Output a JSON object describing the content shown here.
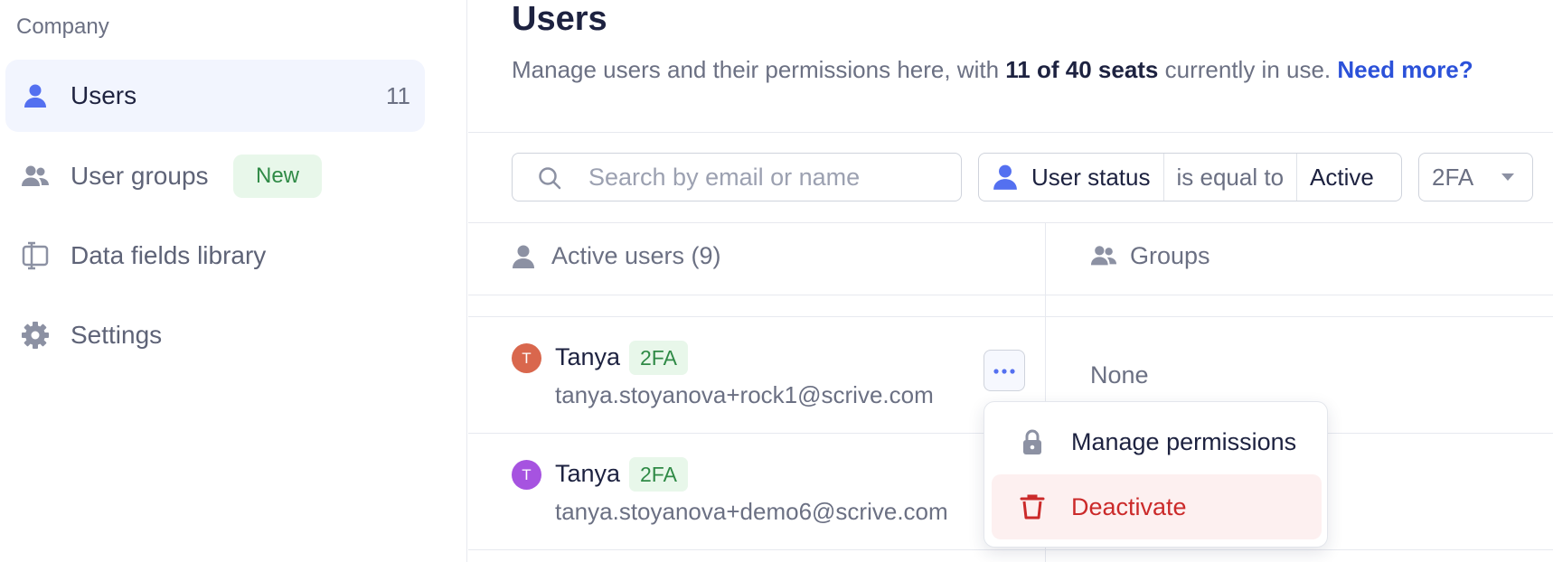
{
  "sidebar": {
    "section_title": "Company",
    "items": [
      {
        "label": "Users",
        "icon": "user-icon",
        "count": "11",
        "active": true
      },
      {
        "label": "User groups",
        "icon": "user-group-icon",
        "badge": "New"
      },
      {
        "label": "Data fields library",
        "icon": "data-fields-icon"
      },
      {
        "label": "Settings",
        "icon": "gear-icon"
      }
    ]
  },
  "header": {
    "title": "Users",
    "subtitle_prefix": "Manage users and their permissions here, with ",
    "subtitle_seats": "11 of 40 seats",
    "subtitle_suffix": " currently in use.",
    "need_more_link": "Need more?"
  },
  "toolbar": {
    "search_placeholder": "Search by email or name",
    "filter": {
      "field": "User status",
      "operator": "is equal to",
      "value": "Active"
    },
    "twofa_select": "2FA"
  },
  "table": {
    "columns": [
      {
        "label": "Active users (9)",
        "icon": "user-icon"
      },
      {
        "label": "Groups",
        "icon": "user-group-icon"
      }
    ],
    "rows": [
      {
        "avatar": "T",
        "avatar_color": "#d9674d",
        "name": "Tanya",
        "badge": "2FA",
        "email": "tanya.stoyanova+rock1@scrive.com",
        "groups": "None"
      },
      {
        "avatar": "T",
        "avatar_color": "#a653e0",
        "name": "Tanya",
        "badge": "2FA",
        "email": "tanya.stoyanova+demo6@scrive.com",
        "groups": ""
      }
    ]
  },
  "row_menu": {
    "items": [
      {
        "label": "Manage permissions",
        "icon": "lock-icon"
      },
      {
        "label": "Deactivate",
        "icon": "trash-icon"
      }
    ]
  },
  "colors": {
    "accent": "#5470f0",
    "link": "#2b51d9",
    "success_bg": "#e8f7ea",
    "success_text": "#2f8a46",
    "danger": "#cb2a2a",
    "danger_bg": "#fdf0f0"
  }
}
